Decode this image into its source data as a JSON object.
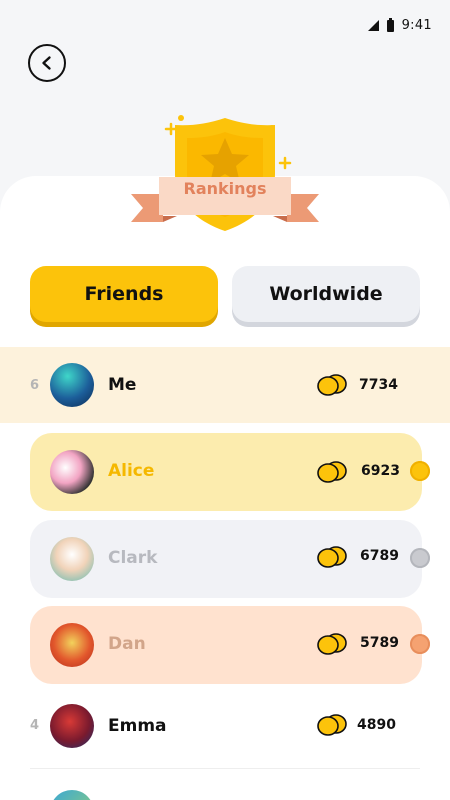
{
  "status_bar": {
    "time": "9:41"
  },
  "header": {
    "back_icon": "chevron-left-icon",
    "badge_label": "Rankings"
  },
  "tabs": [
    {
      "label": "Friends",
      "active": true
    },
    {
      "label": "Worldwide",
      "active": false
    }
  ],
  "current_user": {
    "rank": "6",
    "name": "Me",
    "score": "7734"
  },
  "leaderboard": [
    {
      "name": "Alice",
      "score": "6923",
      "medal": "gold"
    },
    {
      "name": "Clark",
      "score": "6789",
      "medal": "silver"
    },
    {
      "name": "Dan",
      "score": "5789",
      "medal": "bronze"
    },
    {
      "rank": "4",
      "name": "Emma",
      "score": "4890"
    }
  ],
  "colors": {
    "accent": "#fcc30b",
    "gold_card": "#fcecae",
    "silver_card": "#f1f2f6",
    "bronze_card": "#ffe2cf",
    "me_row": "#fdf2dc",
    "gold_name": "#f5b800",
    "silver_name": "#b7b9bf",
    "bronze_name": "#d2a58a"
  }
}
